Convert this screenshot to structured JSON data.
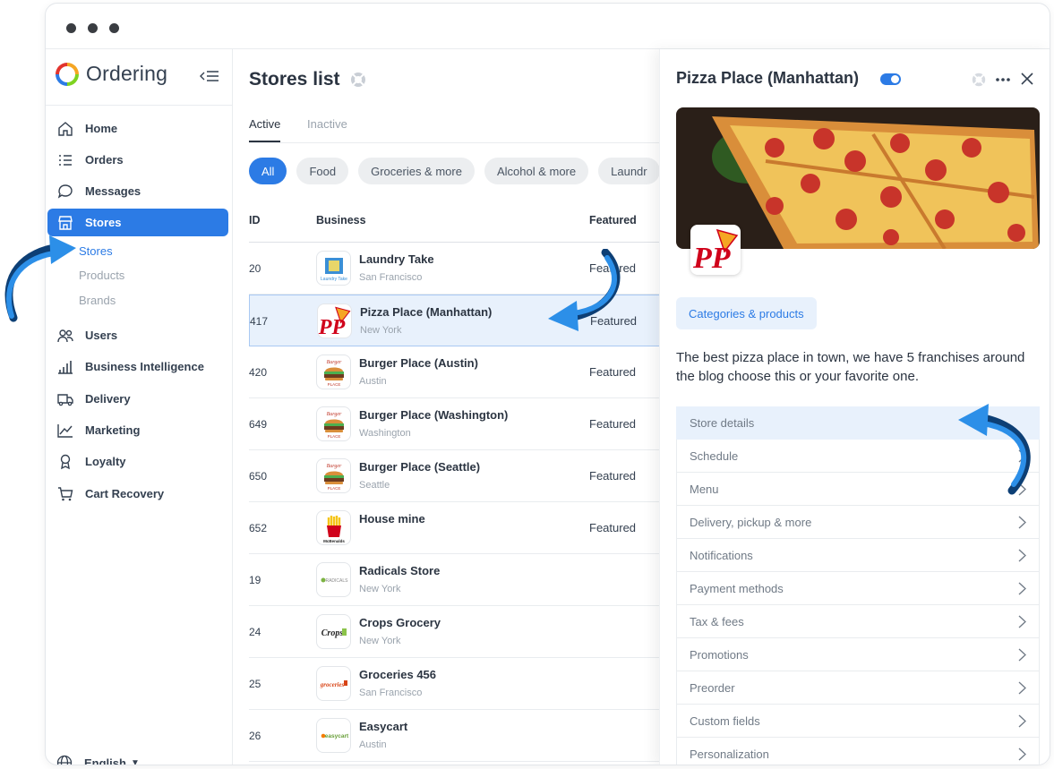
{
  "window": {
    "dots": 3
  },
  "sidebar": {
    "brand": "Ordering",
    "items": [
      {
        "label": "Home",
        "icon": "home-icon"
      },
      {
        "label": "Orders",
        "icon": "list-icon"
      },
      {
        "label": "Messages",
        "icon": "chat-icon"
      },
      {
        "label": "Stores",
        "icon": "store-icon",
        "active": true
      },
      {
        "label": "Users",
        "icon": "users-icon"
      },
      {
        "label": "Business Intelligence",
        "icon": "bar-chart-icon"
      },
      {
        "label": "Delivery",
        "icon": "truck-icon"
      },
      {
        "label": "Marketing",
        "icon": "line-chart-icon"
      },
      {
        "label": "Loyalty",
        "icon": "award-icon"
      },
      {
        "label": "Cart Recovery",
        "icon": "cart-icon"
      }
    ],
    "sub_items": [
      {
        "label": "Stores",
        "active": true
      },
      {
        "label": "Products"
      },
      {
        "label": "Brands"
      }
    ],
    "language": "English"
  },
  "main": {
    "title": "Stores list",
    "tabs": [
      {
        "label": "Active",
        "active": true
      },
      {
        "label": "Inactive"
      }
    ],
    "chips": [
      "All",
      "Food",
      "Groceries & more",
      "Alcohol & more",
      "Laundr"
    ],
    "columns": {
      "id": "ID",
      "business": "Business",
      "featured": "Featured"
    },
    "rows": [
      {
        "id": "20",
        "name": "Laundry Take",
        "city": "San Francisco",
        "featured": "Featured",
        "logo": "laundry"
      },
      {
        "id": "417",
        "name": "Pizza Place (Manhattan)",
        "city": "New York",
        "featured": "Featured",
        "logo": "pp",
        "selected": true
      },
      {
        "id": "420",
        "name": "Burger Place (Austin)",
        "city": "Austin",
        "featured": "Featured",
        "logo": "burger"
      },
      {
        "id": "649",
        "name": "Burger Place (Washington)",
        "city": "Washington",
        "featured": "Featured",
        "logo": "burger"
      },
      {
        "id": "650",
        "name": "Burger Place (Seattle)",
        "city": "Seattle",
        "featured": "Featured",
        "logo": "burger"
      },
      {
        "id": "652",
        "name": "House mine",
        "city": "",
        "featured": "Featured",
        "logo": "fries"
      },
      {
        "id": "19",
        "name": "Radicals Store",
        "city": "New York",
        "featured": "",
        "logo": "radicals"
      },
      {
        "id": "24",
        "name": "Crops Grocery",
        "city": "New York",
        "featured": "",
        "logo": "crops"
      },
      {
        "id": "25",
        "name": "Groceries 456",
        "city": "San Francisco",
        "featured": "",
        "logo": "groceries"
      },
      {
        "id": "26",
        "name": "Easycart",
        "city": "Austin",
        "featured": "",
        "logo": "easycart"
      }
    ]
  },
  "panel": {
    "title": "Pizza Place (Manhattan)",
    "enabled": true,
    "categories_button": "Categories & products",
    "description": "The best pizza place in town, we have 5 franchises around the blog choose this or your favorite one.",
    "menu": [
      {
        "label": "Store details",
        "active": true
      },
      {
        "label": "Schedule"
      },
      {
        "label": "Menu"
      },
      {
        "label": "Delivery, pickup & more"
      },
      {
        "label": "Notifications"
      },
      {
        "label": "Payment methods"
      },
      {
        "label": "Tax & fees"
      },
      {
        "label": "Promotions"
      },
      {
        "label": "Preorder"
      },
      {
        "label": "Custom fields"
      },
      {
        "label": "Personalization"
      }
    ]
  },
  "colors": {
    "accent": "#2c7be5",
    "text": "#344050",
    "muted": "#9aa3ad",
    "selected_bg": "#e8f1fc"
  }
}
